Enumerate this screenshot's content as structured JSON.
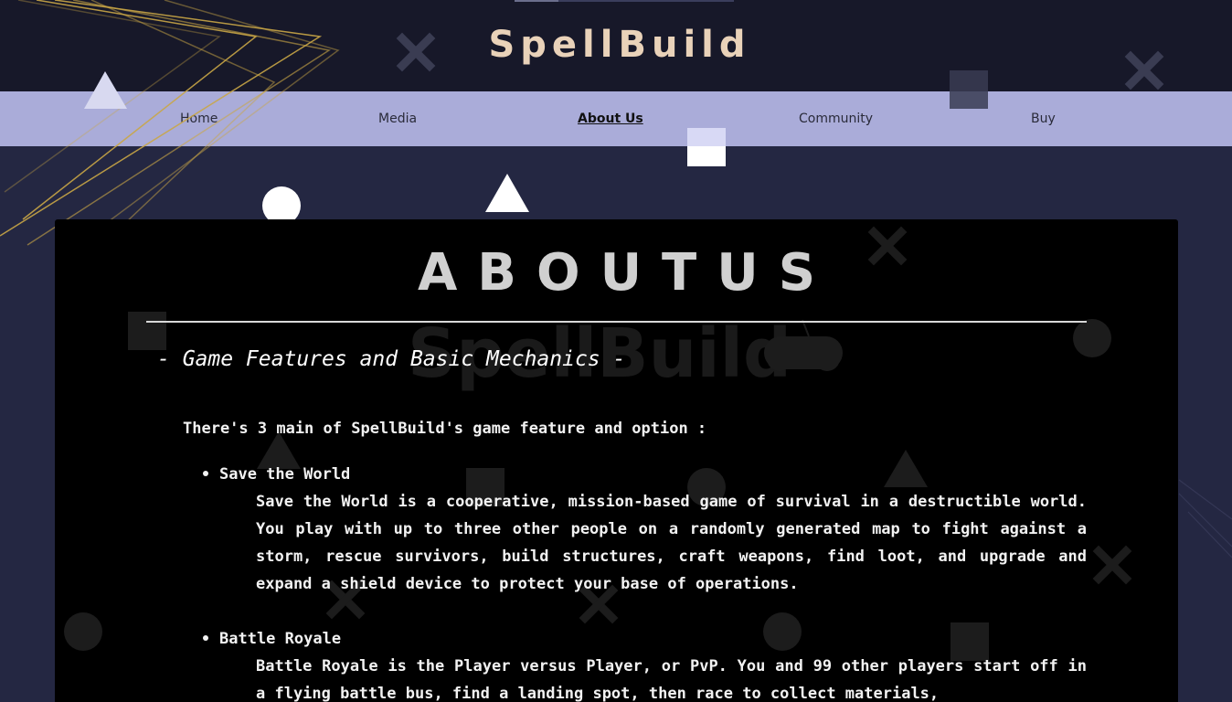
{
  "brand": {
    "name": "SpellBuild"
  },
  "nav": {
    "items": [
      {
        "label": "Home"
      },
      {
        "label": "Media"
      },
      {
        "label": "About Us"
      },
      {
        "label": "Community"
      },
      {
        "label": "Buy"
      }
    ],
    "active": "About Us"
  },
  "panel": {
    "title": "ABOUTUS",
    "watermark": "SpellBuild",
    "section_heading": "- Game Features and Basic Mechanics -",
    "intro": "There's 3 main of SpellBuild's game feature and option :",
    "features": [
      {
        "title": "Save the World",
        "description": "Save the World is a cooperative, mission-based game of survival in a destructible world. You play with up to three other people on a randomly generated map to fight against a storm, rescue survivors, build structures, craft weapons, find loot, and upgrade and expand a shield device to protect your base of operations."
      },
      {
        "title": "Battle Royale",
        "description": "Battle Royale is the Player versus Player, or PvP. You and 99 other players start off in a flying battle bus, find a landing spot, then race to collect materials,"
      }
    ]
  },
  "colors": {
    "page_background": "#242742",
    "header_background": "#171829",
    "nav_background": "#aaacd9",
    "brand_text": "#e9d2b9",
    "panel_background": "#000000",
    "decor_gold": "#c9a646"
  },
  "icons": {
    "decorations": [
      "cross-icon",
      "triangle-icon",
      "square-icon",
      "circle-icon",
      "gamepad-icon"
    ]
  }
}
